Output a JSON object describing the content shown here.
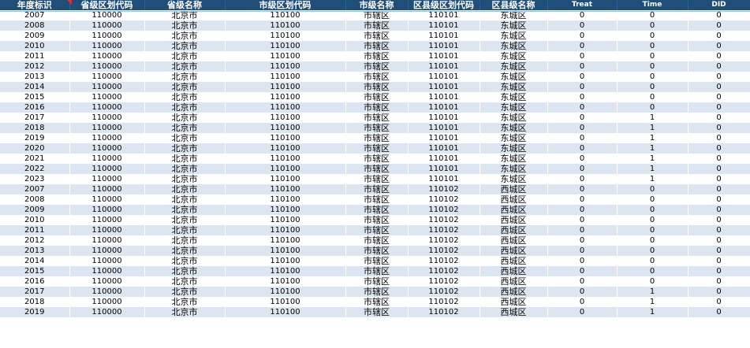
{
  "columns": [
    "年度标识",
    "省级区划代码",
    "省级名称",
    "市级区划代码",
    "市级名称",
    "区县级区划代码",
    "区县级名称",
    "Treat",
    "Time",
    "DID"
  ],
  "rows": [
    [
      "2007",
      "110000",
      "北京市",
      "110100",
      "市辖区",
      "110101",
      "东城区",
      "0",
      "0",
      "0"
    ],
    [
      "2008",
      "110000",
      "北京市",
      "110100",
      "市辖区",
      "110101",
      "东城区",
      "0",
      "0",
      "0"
    ],
    [
      "2009",
      "110000",
      "北京市",
      "110100",
      "市辖区",
      "110101",
      "东城区",
      "0",
      "0",
      "0"
    ],
    [
      "2010",
      "110000",
      "北京市",
      "110100",
      "市辖区",
      "110101",
      "东城区",
      "0",
      "0",
      "0"
    ],
    [
      "2011",
      "110000",
      "北京市",
      "110100",
      "市辖区",
      "110101",
      "东城区",
      "0",
      "0",
      "0"
    ],
    [
      "2012",
      "110000",
      "北京市",
      "110100",
      "市辖区",
      "110101",
      "东城区",
      "0",
      "0",
      "0"
    ],
    [
      "2013",
      "110000",
      "北京市",
      "110100",
      "市辖区",
      "110101",
      "东城区",
      "0",
      "0",
      "0"
    ],
    [
      "2014",
      "110000",
      "北京市",
      "110100",
      "市辖区",
      "110101",
      "东城区",
      "0",
      "0",
      "0"
    ],
    [
      "2015",
      "110000",
      "北京市",
      "110100",
      "市辖区",
      "110101",
      "东城区",
      "0",
      "0",
      "0"
    ],
    [
      "2016",
      "110000",
      "北京市",
      "110100",
      "市辖区",
      "110101",
      "东城区",
      "0",
      "0",
      "0"
    ],
    [
      "2017",
      "110000",
      "北京市",
      "110100",
      "市辖区",
      "110101",
      "东城区",
      "0",
      "1",
      "0"
    ],
    [
      "2018",
      "110000",
      "北京市",
      "110100",
      "市辖区",
      "110101",
      "东城区",
      "0",
      "1",
      "0"
    ],
    [
      "2019",
      "110000",
      "北京市",
      "110100",
      "市辖区",
      "110101",
      "东城区",
      "0",
      "1",
      "0"
    ],
    [
      "2020",
      "110000",
      "北京市",
      "110100",
      "市辖区",
      "110101",
      "东城区",
      "0",
      "1",
      "0"
    ],
    [
      "2021",
      "110000",
      "北京市",
      "110100",
      "市辖区",
      "110101",
      "东城区",
      "0",
      "1",
      "0"
    ],
    [
      "2022",
      "110000",
      "北京市",
      "110100",
      "市辖区",
      "110101",
      "东城区",
      "0",
      "1",
      "0"
    ],
    [
      "2023",
      "110000",
      "北京市",
      "110100",
      "市辖区",
      "110101",
      "东城区",
      "0",
      "1",
      "0"
    ],
    [
      "2007",
      "110000",
      "北京市",
      "110100",
      "市辖区",
      "110102",
      "西城区",
      "0",
      "0",
      "0"
    ],
    [
      "2008",
      "110000",
      "北京市",
      "110100",
      "市辖区",
      "110102",
      "西城区",
      "0",
      "0",
      "0"
    ],
    [
      "2009",
      "110000",
      "北京市",
      "110100",
      "市辖区",
      "110102",
      "西城区",
      "0",
      "0",
      "0"
    ],
    [
      "2010",
      "110000",
      "北京市",
      "110100",
      "市辖区",
      "110102",
      "西城区",
      "0",
      "0",
      "0"
    ],
    [
      "2011",
      "110000",
      "北京市",
      "110100",
      "市辖区",
      "110102",
      "西城区",
      "0",
      "0",
      "0"
    ],
    [
      "2012",
      "110000",
      "北京市",
      "110100",
      "市辖区",
      "110102",
      "西城区",
      "0",
      "0",
      "0"
    ],
    [
      "2013",
      "110000",
      "北京市",
      "110100",
      "市辖区",
      "110102",
      "西城区",
      "0",
      "0",
      "0"
    ],
    [
      "2014",
      "110000",
      "北京市",
      "110100",
      "市辖区",
      "110102",
      "西城区",
      "0",
      "0",
      "0"
    ],
    [
      "2015",
      "110000",
      "北京市",
      "110100",
      "市辖区",
      "110102",
      "西城区",
      "0",
      "0",
      "0"
    ],
    [
      "2016",
      "110000",
      "北京市",
      "110100",
      "市辖区",
      "110102",
      "西城区",
      "0",
      "0",
      "0"
    ],
    [
      "2017",
      "110000",
      "北京市",
      "110100",
      "市辖区",
      "110102",
      "西城区",
      "0",
      "1",
      "0"
    ],
    [
      "2018",
      "110000",
      "北京市",
      "110100",
      "市辖区",
      "110102",
      "西城区",
      "0",
      "1",
      "0"
    ],
    [
      "2019",
      "110000",
      "北京市",
      "110100",
      "市辖区",
      "110102",
      "西城区",
      "0",
      "1",
      "0"
    ]
  ],
  "colors": {
    "header_bg": "#1f4e79",
    "header_text": "#ffffff",
    "band_bg": "#dce6f1",
    "comment_marker": "#e03030"
  }
}
